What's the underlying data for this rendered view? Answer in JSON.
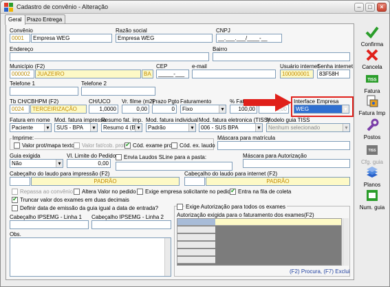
{
  "window": {
    "title": "Cadastro de convênio - Alteração"
  },
  "tabs": [
    "Geral",
    "Prazo Entrega"
  ],
  "row1": {
    "convenio_label": "Convênio",
    "convenio_code": "0001",
    "convenio_name": "Empresa WEG",
    "razao_label": "Razão social",
    "razao_value": "Empresa WEG",
    "cnpj_label": "CNPJ",
    "cnpj_value": "__.___.___/____-__"
  },
  "row2": {
    "endereco_label": "Endereço",
    "bairro_label": "Bairro"
  },
  "row3": {
    "municipio_label": "Município (F2)",
    "municipio_code": "000002",
    "municipio_name": "JUAZEIRO",
    "uf": "BA",
    "cep_label": "CEP",
    "cep_value": "_____-___",
    "email_label": "e-mail",
    "usuario_label": "Usuário internet",
    "usuario_value": "100000001",
    "senha_label": "Senha internet",
    "senha_value": "83F58H"
  },
  "row4": {
    "tel1_label": "Telefone 1",
    "tel2_label": "Telefone 2"
  },
  "row5": {
    "tbch_label": "Tb CH/CBHPM (F2)",
    "tbch_code": "0024",
    "tbch_name": "TERCEIRIZAÇÃO",
    "chuco_label": "CH/UCO",
    "chuco_value": "1,0000",
    "vrfilme_label": "Vr. filme (m2)",
    "vrfilme_value": "0,00",
    "prazo_label": "Prazo Pgto",
    "prazo_value": "0",
    "fat_label": "Faturamento",
    "fat_value": "Fixo",
    "pctfat_label": "% Fatu",
    "pctfat_value": "100,00",
    "extra_value": "0,00",
    "iface_label": "Interface Empresa",
    "iface_value": "WEG"
  },
  "row6": {
    "fatnome_label": "Fatura em nome",
    "fatnome_value": "Paciente",
    "modimp_label": "Mod. fatura impressa",
    "modimp_value": "SUS - BPA",
    "resumo_label": "Resumo fat. imp.",
    "resumo_value": "Resumo 4 (BP",
    "modind_label": "Mod. fatura individual",
    "modind_value": "Padrão",
    "model_label": "Mod. fatura eletronica (TISS)",
    "model_value": "006 - SUS BPA",
    "guia_label": "Modelo guia TISS",
    "guia_value": "Nenhum selecionado"
  },
  "imprime": {
    "label": "Imprime:",
    "valor_prot": "Valor prot/mapa texto",
    "valor_fat": "Valor fat/cob. prot.",
    "cod_exame": "Cód. exame prot.",
    "cod_ex_laudo": "Cód. ex. laudo",
    "mascara_label": "Máscara para matrícula"
  },
  "row8": {
    "guia_exig_label": "Guia exigida",
    "guia_exig_value": "Não",
    "vl_limite_label": "Vl. Limite do Pedido",
    "vl_limite_value": "0,00",
    "envia_laudos": "Envia Laudos SLine para a pasta:",
    "mascara_aut_label": "Máscara para Autorização"
  },
  "row9": {
    "cab_imp_label": "Cabeçalho do laudo para impressão (F2)",
    "cab_imp_value": "PADRÃO",
    "cab_int_label": "Cabeçalho do laudo para internet (F2)",
    "cab_int_value": "PADRÃO"
  },
  "checks": {
    "repassa": "Repassa ao convênio",
    "altera": "Altera Valor no pedido",
    "exige_solic": "Exige empresa solicitante no pedido",
    "entra_fila": "Entra na fila de coleta",
    "truncar": "Truncar valor dos exames em duas decimais",
    "definir": "Definir data de emissão da guia igual a data de entrada?",
    "exige_aut": "Exige Autorização para todos os exames"
  },
  "ipesmg": {
    "l1": "Cabeçalho IPSEMG - Linha 1",
    "l2": "Cabeçalho IPSEMG - Linha 2"
  },
  "obs_label": "Obs.",
  "autorizacao": {
    "label": "Autorização exigida para o faturamento dos exames(F2)",
    "hint": "(F2) Procura, (F7) Exclui"
  },
  "side": [
    {
      "label": "Confirma",
      "icon": "checkmark-icon"
    },
    {
      "label": "Cancela",
      "icon": "x-icon"
    },
    {
      "label": "Fatura",
      "icon": "tiss-icon"
    },
    {
      "label": "Fatura Imp",
      "icon": "print-icon"
    },
    {
      "label": "Postos",
      "icon": "wrench-icon"
    },
    {
      "label": "Cfg. guia",
      "icon": "tiss-guia-icon"
    },
    {
      "label": "Planos",
      "icon": "layers-icon"
    },
    {
      "label": "Num. guia",
      "icon": "guia-number-icon"
    }
  ],
  "colors": {
    "accent_red": "#e0201a",
    "highlight_blue": "#2f6fd0",
    "field_yellow": "#fdf9c6"
  }
}
